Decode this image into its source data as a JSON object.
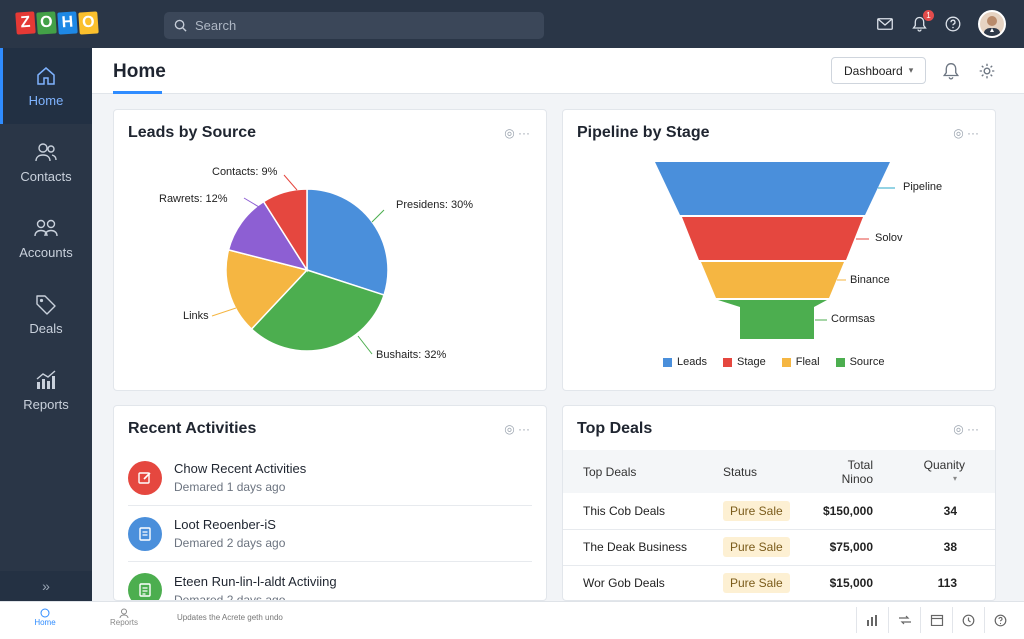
{
  "app": {
    "logo_letters": [
      {
        "char": "Z",
        "color": "#e53935"
      },
      {
        "char": "O",
        "color": "#43a047"
      },
      {
        "char": "H",
        "color": "#1e88e5"
      },
      {
        "char": "O",
        "color": "#fbc02d"
      }
    ]
  },
  "search": {
    "placeholder": "Search"
  },
  "topbar": {
    "notification_count": "1",
    "icons": [
      "mail-icon",
      "bell-icon",
      "help-icon"
    ]
  },
  "sidebar": {
    "items": [
      {
        "label": "Home",
        "icon": "home-icon",
        "active": true
      },
      {
        "label": "Contacts",
        "icon": "contacts-icon"
      },
      {
        "label": "Accounts",
        "icon": "accounts-icon"
      },
      {
        "label": "Deals",
        "icon": "deals-icon"
      },
      {
        "label": "Reports",
        "icon": "reports-icon"
      }
    ],
    "collapse_glyph": "»"
  },
  "header": {
    "title": "Home",
    "dashboard_label": "Dashboard",
    "dashboard_caret": "▾"
  },
  "leads": {
    "title": "Leads by Source",
    "tools": "◎ ···",
    "labels": {
      "contacts": "Contacts: 9%",
      "rawrets": "Rawrets: 12%",
      "presidens": "Presidens: 30%",
      "links": "Links",
      "bushaits": "Bushaits: 32%"
    }
  },
  "pipeline": {
    "title": "Pipeline by Stage",
    "tools": "◎ ···",
    "stages": [
      "Pipeline",
      "Solov",
      "Binance",
      "Cormsas"
    ],
    "legend": [
      {
        "label": "Leads",
        "color": "#4a8fdb"
      },
      {
        "label": "Stage",
        "color": "#e5473f"
      },
      {
        "label": "Fleal",
        "color": "#f5b642"
      },
      {
        "label": "Source",
        "color": "#4cae4f"
      }
    ]
  },
  "activities": {
    "title": "Recent Activities",
    "tools": "◎ ···",
    "items": [
      {
        "title": "Chow Recent Activities",
        "sub": "Demared 1 days ago",
        "color": "#e5473f",
        "icon": "edit-icon"
      },
      {
        "title": "Loot Reoenber-iS",
        "sub": "Demared 2 days ago",
        "color": "#4a8fdb",
        "icon": "note-icon"
      },
      {
        "title": "Eteen Run-lin-l-aldt Activiing",
        "sub": "Demared 2 days ago",
        "color": "#4cae4f",
        "icon": "list-icon"
      }
    ]
  },
  "deals": {
    "title": "Top Deals",
    "tools": "◎ ···",
    "columns": [
      "Top Deals",
      "Status",
      "Total Ninoo",
      "Quanity"
    ],
    "sort_glyph": "▾",
    "rows": [
      {
        "name": "This Cob Deals",
        "status": "Pure Sale",
        "total": "$150,000",
        "qty": "34"
      },
      {
        "name": "The Deak Business",
        "status": "Pure Sale",
        "total": "$75,000",
        "qty": "38"
      },
      {
        "name": "Wor Gob Deals",
        "status": "Pure Sale",
        "total": "$15,000",
        "qty": "113"
      }
    ]
  },
  "bottombar": {
    "home": "Home",
    "reports": "Reports",
    "status": "Updates the Acrete geth undo"
  },
  "chart_data": [
    {
      "type": "pie",
      "title": "Leads by Source",
      "slices": [
        {
          "label": "Presidens",
          "value": 30,
          "color": "#4a8fdb"
        },
        {
          "label": "Bushaits",
          "value": 32,
          "color": "#4cae4f"
        },
        {
          "label": "Links",
          "value": null,
          "color": "#f5b642"
        },
        {
          "label": "Rawrets",
          "value": 12,
          "color": "#8d5fd3"
        },
        {
          "label": "Contacts",
          "value": 9,
          "color": "#e5473f"
        }
      ]
    },
    {
      "type": "bar",
      "title": "Pipeline by Stage",
      "categories": [
        "Pipeline",
        "Solov",
        "Binance",
        "Cormsas"
      ]
    }
  ]
}
